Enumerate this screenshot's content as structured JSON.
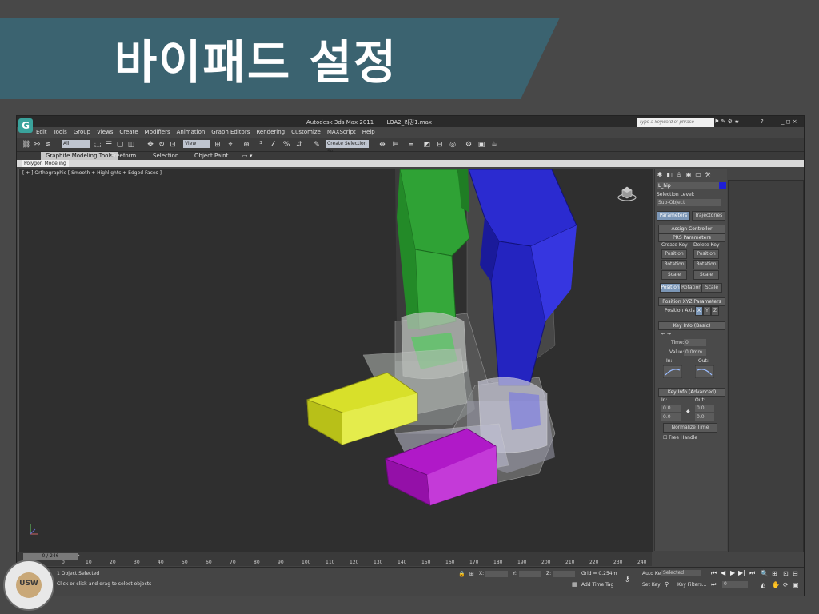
{
  "slide": {
    "title": "바이패드 설정"
  },
  "window": {
    "app_title": "Autodesk 3ds Max  2011",
    "file_name": "LOA2_리깅1.max",
    "search_placeholder": "Type a keyword or phrase",
    "controls": "_ ◻ ×"
  },
  "menu": [
    "Edit",
    "Tools",
    "Group",
    "Views",
    "Create",
    "Modifiers",
    "Animation",
    "Graph Editors",
    "Rendering",
    "Customize",
    "MAXScript",
    "Help"
  ],
  "toolbar": {
    "filter": "All",
    "ref_coord": "View",
    "named_selection": "Create Selection Se"
  },
  "ribbon": {
    "tabs": [
      "Graphite Modeling Tools",
      "Freeform",
      "Selection",
      "Object Paint"
    ],
    "sub_tab": "Polygon Modeling"
  },
  "viewport": {
    "label": "[ + ] Orthographic [ Smooth + Highlights + Edged Faces ]"
  },
  "command_panel": {
    "object_name": "L_hip",
    "selection_level_label": "Selection Level:",
    "selection_level_value": "Sub-Object",
    "tabs": [
      "Parameters",
      "Trajectories"
    ],
    "assign_controller": "Assign Controller",
    "prs_title": "PRS Parameters",
    "create_key": "Create Key",
    "delete_key": "Delete Key",
    "key_buttons": [
      "Position",
      "Rotation",
      "Scale"
    ],
    "prs_tabs": [
      "Position",
      "Rotation",
      "Scale"
    ],
    "xyz_title": "Position XYZ Parameters",
    "position_axis_label": "Position Axis:",
    "axes": [
      "X",
      "Y",
      "Z"
    ],
    "key_info_basic": "Key Info (Basic)",
    "time_label": "Time:",
    "time_value": "0",
    "value_label": "Value:",
    "value_value": "0.0mm",
    "in_label": "In:",
    "out_label": "Out:",
    "key_info_advanced": "Key Info (Advanced)",
    "adv_in": "In:",
    "adv_out": "Out:",
    "adv_values": [
      "0.0",
      "0.0",
      "0.0",
      "0.0"
    ],
    "normalize_time": "Normalize Time",
    "free_handle": "Free Handle"
  },
  "timeline": {
    "slider": "0 / 246",
    "ticks": [
      "0",
      "10",
      "20",
      "30",
      "40",
      "50",
      "60",
      "70",
      "80",
      "90",
      "100",
      "110",
      "120",
      "130",
      "140",
      "150",
      "160",
      "170",
      "180",
      "190",
      "200",
      "210",
      "220",
      "230",
      "240"
    ]
  },
  "status": {
    "selection": "1 Object Selected",
    "prompt": "Click or click-and-drag to select objects",
    "x_label": "X:",
    "y_label": "Y:",
    "z_label": "Z:",
    "grid": "Grid = 0.254m",
    "add_time_tag": "Add Time Tag",
    "auto_key": "Auto Key",
    "selected": "Selected",
    "set_key": "Set Key",
    "key_filters": "Key Filters...",
    "frame": "0"
  },
  "seal": {
    "text": "USW"
  },
  "colors": {
    "banner": "#3b6370",
    "left_leg": "#35a83a",
    "right_leg": "#2b2bd0",
    "left_toe": "#d8e02a",
    "right_toe": "#b019c8"
  }
}
